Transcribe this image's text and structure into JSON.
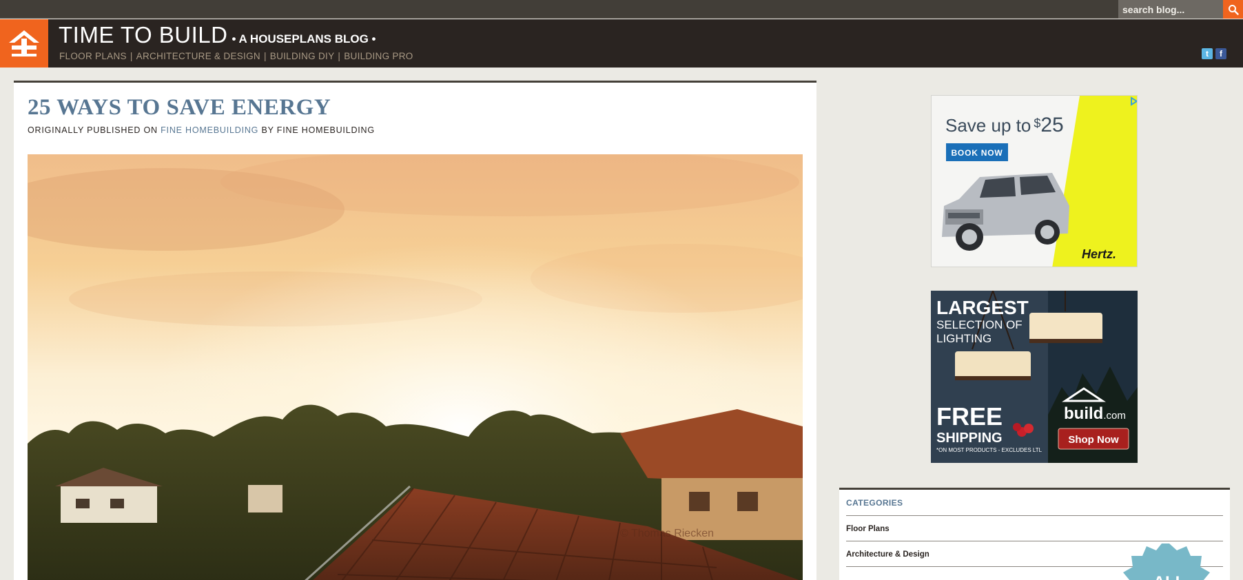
{
  "search": {
    "placeholder": "search blog..."
  },
  "header": {
    "title": "TIME TO BUILD",
    "tagline": "• A HOUSEPLANS BLOG •",
    "nav": [
      "FLOOR PLANS",
      "ARCHITECTURE & DESIGN",
      "BUILDING DIY",
      "BUILDING PRO"
    ],
    "nav_separator": "|"
  },
  "social": {
    "twitter_icon": "t",
    "facebook_icon": "f"
  },
  "post": {
    "title": "25 WAYS TO SAVE ENERGY",
    "byline_prefix": "ORIGINALLY PUBLISHED ON",
    "byline_source": "FINE HOMEBUILDING",
    "byline_by": "BY FINE HOMEBUILDING",
    "image_watermark": "© Thomas Riecken"
  },
  "ads": {
    "hertz": {
      "headline_prefix": "Save up to",
      "amount_symbol": "$",
      "amount": "25",
      "cta": "BOOK NOW",
      "brand": "Hertz."
    },
    "build": {
      "line1": "LARGEST",
      "line2": "SELECTION OF",
      "line3": "LIGHTING",
      "free": "FREE",
      "shipping": "SHIPPING",
      "fine_print": "*ON MOST PRODUCTS - EXCLUDES LTL",
      "brand_main": "build",
      "brand_suffix": ".com",
      "cta": "Shop Now"
    }
  },
  "categories": {
    "title": "CATEGORIES",
    "items": [
      "Floor Plans",
      "Architecture & Design"
    ],
    "badge": "ALL"
  },
  "colors": {
    "accent": "#f0641e",
    "header_bg": "#2a2421",
    "link": "#577692",
    "page_bg": "#ebeae4"
  }
}
